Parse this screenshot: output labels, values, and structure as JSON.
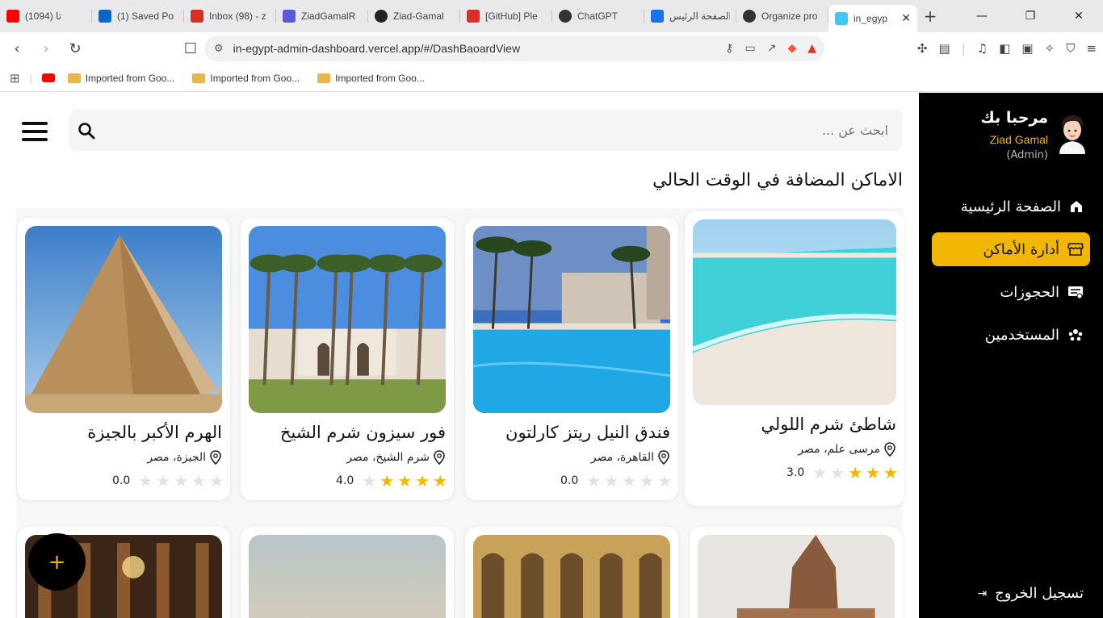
{
  "browser": {
    "tabs": [
      {
        "label": "(1094) تا",
        "icon": "youtube-icon",
        "color": "#ff0000"
      },
      {
        "label": "(1) Saved Po",
        "icon": "linkedin-icon",
        "color": "#0a66c2"
      },
      {
        "label": "Inbox (98) - z",
        "icon": "gmail-icon",
        "color": "#d93025"
      },
      {
        "label": "ZiadGamalR",
        "icon": "app-icon",
        "color": "#5b5bd6"
      },
      {
        "label": "Ziad-Gamal",
        "icon": "github-icon",
        "color": "#222222"
      },
      {
        "label": "[GitHub] Ple",
        "icon": "gmail-icon",
        "color": "#d93025"
      },
      {
        "label": "ChatGPT",
        "icon": "chatgpt-icon",
        "color": "#333333"
      },
      {
        "label": "الصفحة الرئيس",
        "icon": "edge-icon",
        "color": "#1a73e8"
      },
      {
        "label": "Organize pro",
        "icon": "chatgpt-icon",
        "color": "#333333"
      },
      {
        "label": "in_egyp",
        "icon": "flutter-icon",
        "color": "#47c5fb",
        "active": true
      }
    ],
    "url": "in-egypt-admin-dashboard.vercel.app/#/DashBaoardView",
    "bookmarks": [
      "Imported from Goo...",
      "Imported from Goo...",
      "Imported from Goo..."
    ]
  },
  "search": {
    "placeholder": "ابحث عن ..."
  },
  "heading": "الاماكن المضافة في الوقت الحالي",
  "places": [
    {
      "name": "شاطئ شرم اللولي",
      "location": "مرسى علم، مصر",
      "rating": 3,
      "rating_label": "3.0",
      "image": "beach"
    },
    {
      "name": "فندق النيل ريتز كارلتون",
      "location": "القاهرة، مصر",
      "rating": 0,
      "rating_label": "0.0",
      "image": "pool"
    },
    {
      "name": "فور سيزون شرم الشيخ",
      "location": "شرم الشيخ، مصر",
      "rating": 4,
      "rating_label": "4.0",
      "image": "palms"
    },
    {
      "name": "الهرم الأكبر بالجيزة",
      "location": "الجيزة، مصر",
      "rating": 0,
      "rating_label": "0.0",
      "image": "pyramid"
    }
  ],
  "sidebar": {
    "welcome": "مرحبا بك",
    "user_name": "Ziad Gamal",
    "user_role": "(Admin)",
    "items": [
      {
        "label": "الصفحة الرئيسية",
        "icon": "home-icon"
      },
      {
        "label": "أدارة الأماكن",
        "icon": "store-icon",
        "active": true
      },
      {
        "label": "الحجوزات",
        "icon": "bookings-icon"
      },
      {
        "label": "المستخدمين",
        "icon": "users-icon"
      }
    ],
    "logout": "تسجيل الخروج"
  },
  "fab": {
    "label": "+"
  },
  "colors": {
    "accent": "#f2b705",
    "sidebar_bg": "#000000"
  }
}
